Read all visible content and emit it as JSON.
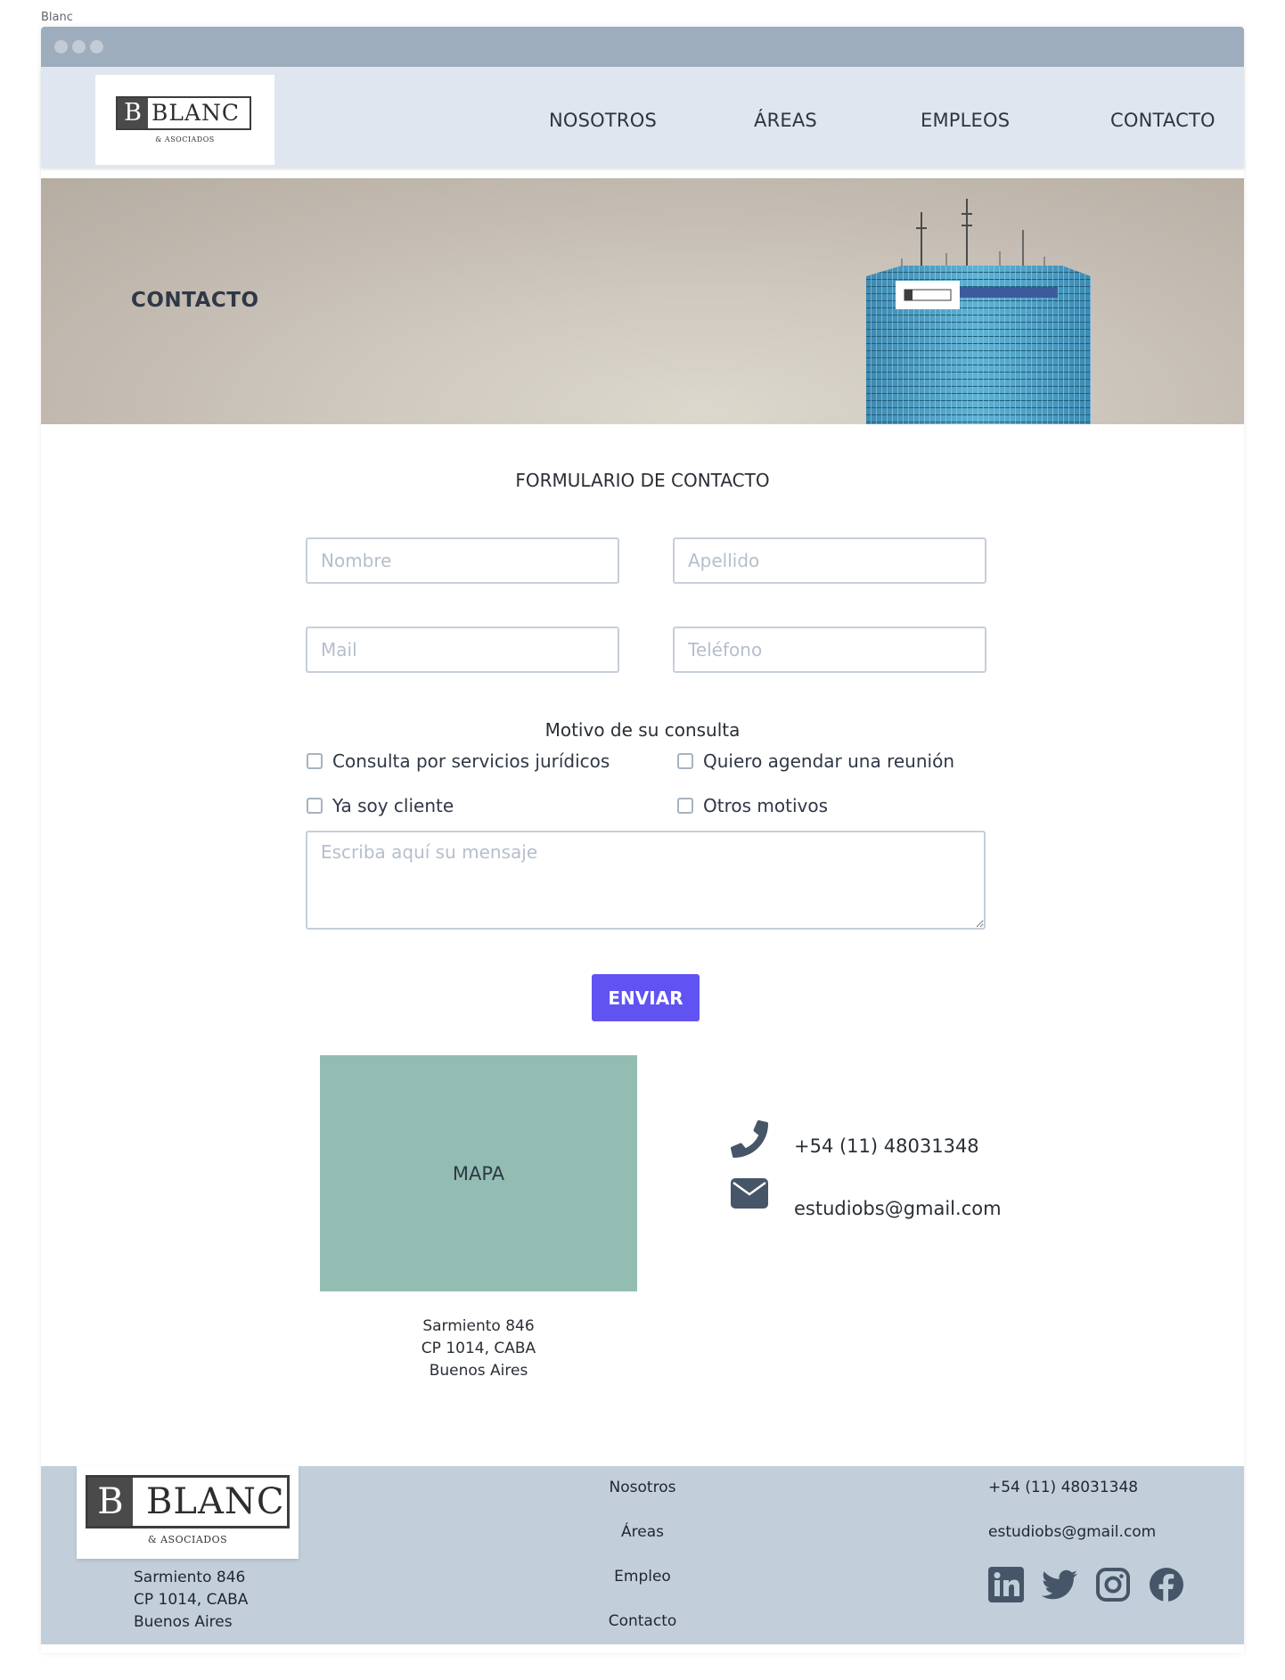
{
  "frame_labels": {
    "top": "Blanc",
    "footer": "footer"
  },
  "brand": {
    "initial": "B",
    "name": "BLANC",
    "subtitle": "& ASOCIADOS"
  },
  "nav": {
    "items": [
      {
        "label": "NOSOTROS"
      },
      {
        "label": "ÁREAS"
      },
      {
        "label": "EMPLEOS"
      },
      {
        "label": "CONTACTO"
      }
    ]
  },
  "hero": {
    "title": "CONTACTO"
  },
  "form": {
    "title": "FORMULARIO DE CONTACTO",
    "fields": {
      "nombre": {
        "placeholder": "Nombre",
        "value": ""
      },
      "apellido": {
        "placeholder": "Apellido",
        "value": ""
      },
      "mail": {
        "placeholder": "Mail",
        "value": ""
      },
      "telefono": {
        "placeholder": "Teléfono",
        "value": ""
      }
    },
    "motivo_title": "Motivo de su consulta",
    "motivos": [
      {
        "label": "Consulta por servicios jurídicos",
        "checked": false
      },
      {
        "label": "Quiero agendar una reunión",
        "checked": false
      },
      {
        "label": "Ya soy cliente",
        "checked": false
      },
      {
        "label": "Otros motivos",
        "checked": false
      }
    ],
    "message_placeholder": "Escriba aquí su mensaje",
    "submit_label": "ENVIAR"
  },
  "location": {
    "map_label": "MAPA",
    "address": [
      "Sarmiento 846",
      "CP 1014, CABA",
      "Buenos Aires"
    ]
  },
  "contact": {
    "phone": "+54 (11) 48031348",
    "email": "estudiobs@gmail.com",
    "phone_icon": "phone-icon",
    "email_icon": "envelope-icon"
  },
  "footer": {
    "address": [
      "Sarmiento 846",
      "CP 1014, CABA",
      "Buenos Aires"
    ],
    "links": [
      "Nosotros",
      "Áreas",
      "Empleo",
      "Contacto"
    ],
    "phone": "+54 (11) 48031348",
    "email": "estudiobs@gmail.com",
    "social": [
      "linkedin-icon",
      "twitter-icon",
      "instagram-icon",
      "facebook-icon"
    ]
  },
  "colors": {
    "accent": "#6153f2",
    "nav_bg": "#e0e6ef",
    "footer_bg": "#c2cfda",
    "map_bg": "#93bdb2",
    "icon": "#465668"
  }
}
